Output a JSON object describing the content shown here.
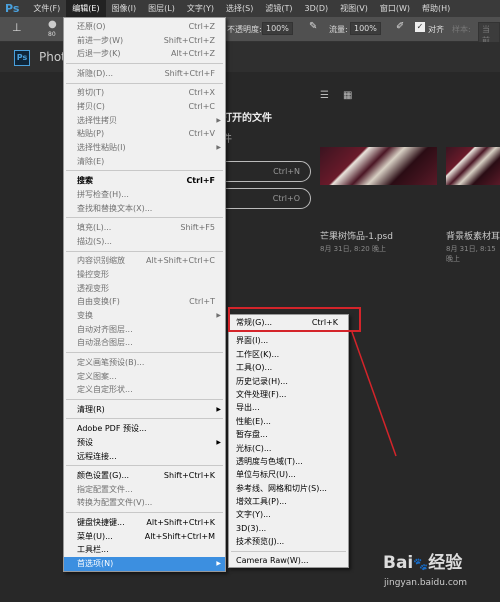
{
  "app": {
    "logo": "Ps",
    "tab_title": "Phot"
  },
  "menubar": [
    "文件(F)",
    "编辑(E)",
    "图像(I)",
    "图层(L)",
    "文字(Y)",
    "选择(S)",
    "滤镜(T)",
    "3D(D)",
    "视图(V)",
    "窗口(W)",
    "帮助(H)"
  ],
  "optbar": {
    "opacity_label": "不透明度:",
    "opacity": "100%",
    "flow_label": "流量:",
    "flow": "100%",
    "align_label": "对齐",
    "sample_label": "样本:",
    "sample_value": "当前图",
    "brush_size": "80"
  },
  "welcome": {
    "heading": "打开的文件",
    "subheading": "件",
    "new_shortcut": "Ctrl+N",
    "open_shortcut": "Ctrl+O",
    "files": [
      {
        "name": "芒果树饰品-1.psd",
        "date": "8月 31日, 8:20 晚上"
      },
      {
        "name": "背景板素材耳",
        "date": "8月 31日, 8:15 晚上"
      }
    ]
  },
  "edit_menu": [
    {
      "label": "还原(O)",
      "shortcut": "Ctrl+Z",
      "disabled": true
    },
    {
      "label": "前进一步(W)",
      "shortcut": "Shift+Ctrl+Z",
      "disabled": true
    },
    {
      "label": "后退一步(K)",
      "shortcut": "Alt+Ctrl+Z",
      "disabled": true
    },
    {
      "sep": true
    },
    {
      "label": "渐隐(D)...",
      "shortcut": "Shift+Ctrl+F",
      "disabled": true
    },
    {
      "sep": true
    },
    {
      "label": "剪切(T)",
      "shortcut": "Ctrl+X",
      "disabled": true
    },
    {
      "label": "拷贝(C)",
      "shortcut": "Ctrl+C",
      "disabled": true
    },
    {
      "label": "选择性拷贝",
      "submenu": true,
      "disabled": true
    },
    {
      "label": "粘贴(P)",
      "shortcut": "Ctrl+V",
      "disabled": true
    },
    {
      "label": "选择性粘贴(I)",
      "submenu": true,
      "disabled": true
    },
    {
      "label": "清除(E)",
      "disabled": true
    },
    {
      "sep": true
    },
    {
      "label": "搜索",
      "shortcut": "Ctrl+F",
      "bold": true
    },
    {
      "label": "拼写检查(H)...",
      "disabled": true
    },
    {
      "label": "查找和替换文本(X)...",
      "disabled": true
    },
    {
      "sep": true
    },
    {
      "label": "填充(L)...",
      "shortcut": "Shift+F5",
      "disabled": true
    },
    {
      "label": "描边(S)...",
      "disabled": true
    },
    {
      "sep": true
    },
    {
      "label": "内容识别缩放",
      "shortcut": "Alt+Shift+Ctrl+C",
      "disabled": true
    },
    {
      "label": "操控变形",
      "disabled": true
    },
    {
      "label": "透视变形",
      "disabled": true
    },
    {
      "label": "自由变换(F)",
      "shortcut": "Ctrl+T",
      "disabled": true
    },
    {
      "label": "变换",
      "submenu": true,
      "disabled": true
    },
    {
      "label": "自动对齐图层...",
      "disabled": true
    },
    {
      "label": "自动混合图层...",
      "disabled": true
    },
    {
      "sep": true
    },
    {
      "label": "定义画笔预设(B)...",
      "disabled": true
    },
    {
      "label": "定义图案...",
      "disabled": true
    },
    {
      "label": "定义自定形状...",
      "disabled": true
    },
    {
      "sep": true
    },
    {
      "label": "清理(R)",
      "submenu": true
    },
    {
      "sep": true
    },
    {
      "label": "Adobe PDF 预设..."
    },
    {
      "label": "预设",
      "submenu": true
    },
    {
      "label": "远程连接..."
    },
    {
      "sep": true
    },
    {
      "label": "颜色设置(G)...",
      "shortcut": "Shift+Ctrl+K"
    },
    {
      "label": "指定配置文件...",
      "disabled": true
    },
    {
      "label": "转换为配置文件(V)...",
      "disabled": true
    },
    {
      "sep": true
    },
    {
      "label": "键盘快捷键...",
      "shortcut": "Alt+Shift+Ctrl+K"
    },
    {
      "label": "菜单(U)...",
      "shortcut": "Alt+Shift+Ctrl+M"
    },
    {
      "label": "工具栏..."
    },
    {
      "label": "首选项(N)",
      "submenu": true,
      "highlighted": true
    }
  ],
  "prefs_menu": [
    {
      "label": "常规(G)...",
      "shortcut": "Ctrl+K"
    },
    {
      "sep": true
    },
    {
      "label": "界面(I)..."
    },
    {
      "label": "工作区(K)..."
    },
    {
      "label": "工具(O)..."
    },
    {
      "label": "历史记录(H)..."
    },
    {
      "label": "文件处理(F)..."
    },
    {
      "label": "导出..."
    },
    {
      "label": "性能(E)..."
    },
    {
      "label": "暂存盘..."
    },
    {
      "label": "光标(C)..."
    },
    {
      "label": "透明度与色域(T)..."
    },
    {
      "label": "单位与标尺(U)..."
    },
    {
      "label": "参考线、网格和切片(S)..."
    },
    {
      "label": "增效工具(P)..."
    },
    {
      "label": "文字(Y)..."
    },
    {
      "label": "3D(3)..."
    },
    {
      "label": "技术预览(J)..."
    },
    {
      "sep": true
    },
    {
      "label": "Camera Raw(W)..."
    }
  ],
  "watermark": {
    "brand": "Bai度经验",
    "url": "jingyan.baidu.com"
  },
  "colors": {
    "highlight": "#3c8fe0",
    "annotation": "#d4242a",
    "menu_bg": "#f0f0f0"
  }
}
